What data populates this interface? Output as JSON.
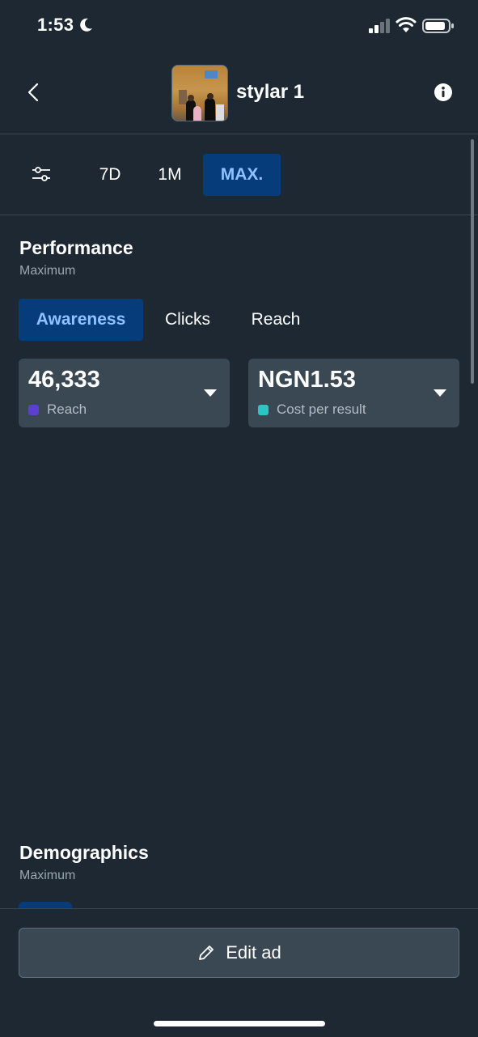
{
  "status_bar": {
    "time": "1:53",
    "icons": [
      "moon-icon",
      "signal-icon",
      "wifi-icon",
      "battery-icon"
    ]
  },
  "header": {
    "back_icon": "chevron-left-icon",
    "account_name": "stylar 1",
    "info_icon": "info-icon"
  },
  "date_range": {
    "filter_icon": "sliders-icon",
    "options": [
      "7D",
      "1M",
      "MAX."
    ],
    "selected": "MAX."
  },
  "performance": {
    "title": "Performance",
    "subtitle": "Maximum",
    "tabs": [
      "Awareness",
      "Clicks",
      "Reach"
    ],
    "selected_tab": "Awareness",
    "metrics": [
      {
        "value": "46,333",
        "label": "Reach",
        "color": "#5b3fd0"
      },
      {
        "value": "NGN1.53",
        "label": "Cost per result",
        "color": "#2ec4c4"
      }
    ]
  },
  "demographics": {
    "title": "Demographics",
    "subtitle": "Maximum"
  },
  "footer": {
    "edit_label": "Edit ad",
    "edit_icon": "pencil-icon"
  },
  "colors": {
    "background": "#1d2832",
    "card": "#394853",
    "accent_bg": "#073c7a",
    "accent_text": "#8fc2ff"
  }
}
